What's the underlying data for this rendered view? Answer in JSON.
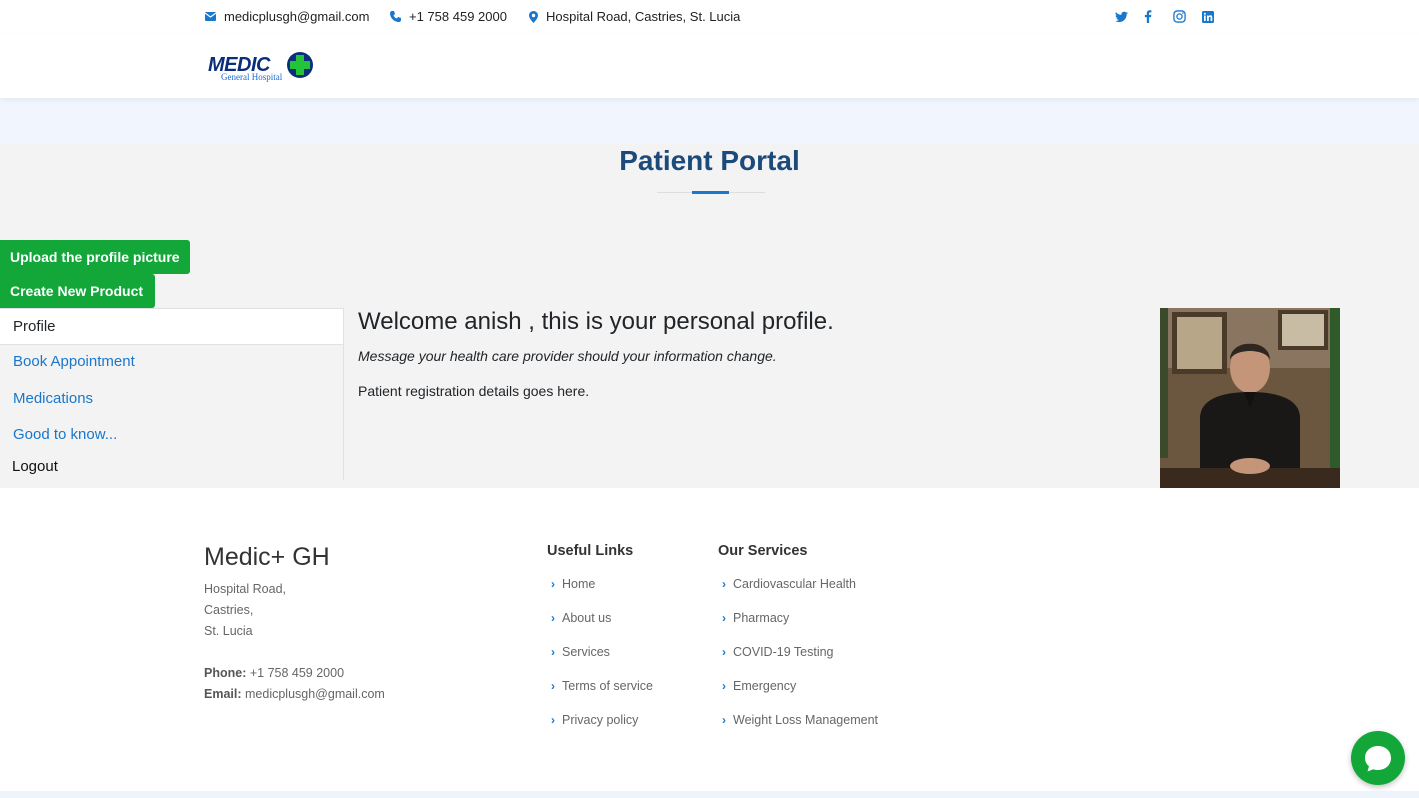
{
  "topbar": {
    "email": "medicplusgh@gmail.com",
    "phone": "+1 758 459 2000",
    "address": "Hospital Road, Castries, St. Lucia",
    "social": [
      "twitter-icon",
      "facebook-icon",
      "instagram-icon",
      "linkedin-icon"
    ]
  },
  "logo": {
    "main": "MEDIC",
    "sub": "General Hospital"
  },
  "page": {
    "title": "Patient Portal",
    "upload_button": "Upload the profile picture",
    "create_button": "Create New Product"
  },
  "sidebar": {
    "items": [
      {
        "label": "Profile",
        "active": true
      },
      {
        "label": "Book Appointment"
      },
      {
        "label": "Medications"
      },
      {
        "label": "Good to know..."
      },
      {
        "label": "Logout"
      }
    ]
  },
  "profile": {
    "welcome": "Welcome anish , this is your personal profile.",
    "message": "Message your health care provider should your information change.",
    "details": "Patient registration details goes here."
  },
  "footer": {
    "brand": "Medic+ GH",
    "address_lines": [
      "Hospital Road,",
      "Castries,",
      "St. Lucia"
    ],
    "phone_label": "Phone:",
    "phone": "+1 758 459 2000",
    "email_label": "Email:",
    "email": "medicplusgh@gmail.com",
    "useful_links_title": "Useful Links",
    "useful_links": [
      "Home",
      "About us",
      "Services",
      "Terms of service",
      "Privacy policy"
    ],
    "services_title": "Our Services",
    "services": [
      "Cardiovascular Health",
      "Pharmacy",
      "COVID-19 Testing",
      "Emergency",
      "Weight Loss Management"
    ]
  },
  "colors": {
    "accent": "#1977cc",
    "green": "#13a73a",
    "title": "#1c4a7a"
  }
}
